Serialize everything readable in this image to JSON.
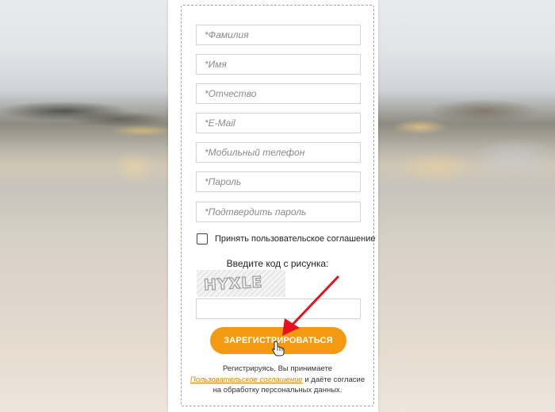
{
  "form": {
    "fields": [
      {
        "placeholder": "*Фамилия"
      },
      {
        "placeholder": "*Имя"
      },
      {
        "placeholder": "*Отчество"
      },
      {
        "placeholder": "*E-Mail"
      },
      {
        "placeholder": "*Мобильный телефон"
      },
      {
        "placeholder": "*Пароль"
      },
      {
        "placeholder": "*Подтвердить пароль"
      }
    ],
    "agreement_label": "Принять пользовательское соглашение",
    "captcha_label": "Введите код с рисунка:",
    "captcha_text": "HYXLE",
    "captcha_value": "",
    "submit_label": "ЗАРЕГИСТРИРОВАТЬСЯ",
    "note_line1": "Регистрируясь, Вы принимаете",
    "note_link": "Пользовательское соглашение",
    "note_line2_rest": " и даёте согласие",
    "note_line3": "на обработку персональных данных."
  },
  "colors": {
    "accent": "#f39a12",
    "link": "#e67e00",
    "annotation_arrow": "#e8101a"
  },
  "icons": {
    "annotation": "red-arrow-icon",
    "pointer": "hand-cursor-icon"
  }
}
